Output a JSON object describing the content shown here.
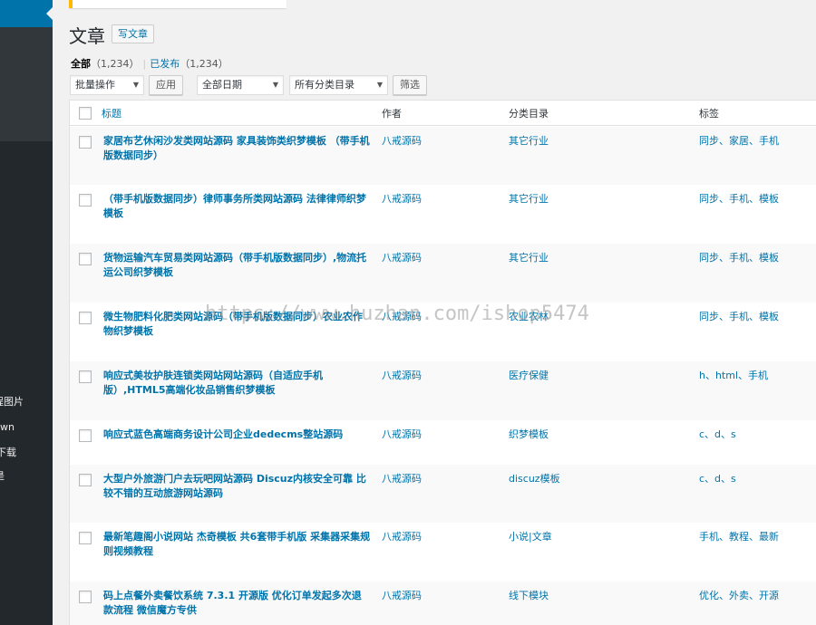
{
  "sidebar": {
    "items": [
      {
        "label": "远程图片"
      },
      {
        "label": "wn"
      },
      {
        "label": "下载"
      },
      {
        "label": "是"
      }
    ]
  },
  "header": {
    "title": "文章",
    "add_new_label": "写文章"
  },
  "filters": {
    "all_label": "全部",
    "all_count": "（1,234）",
    "separator": "|",
    "published_label": "已发布",
    "published_count": "（1,234）"
  },
  "toolbar": {
    "bulk_action": "批量操作",
    "apply_label": "应用",
    "date_filter": "全部日期",
    "category_filter": "所有分类目录",
    "filter_label": "筛选",
    "caret": "▼"
  },
  "table": {
    "columns": {
      "title": "标题",
      "author": "作者",
      "category": "分类目录",
      "tags": "标签"
    },
    "rows": [
      {
        "title": "家居布艺休闲沙发类网站源码 家具装饰类织梦模板 （带手机版数据同步）",
        "author": "八戒源码",
        "category": "其它行业",
        "tags": "同步、家居、手机"
      },
      {
        "title": "（带手机版数据同步）律师事务所类网站源码 法律律师织梦模板",
        "author": "八戒源码",
        "category": "其它行业",
        "tags": "同步、手机、模板"
      },
      {
        "title": "货物运输汽车贸易类网站源码（带手机版数据同步）,物流托运公司织梦模板",
        "author": "八戒源码",
        "category": "其它行业",
        "tags": "同步、手机、模板"
      },
      {
        "title": "微生物肥料化肥类网站源码（带手机版数据同步）农业农作物织梦模板",
        "author": "八戒源码",
        "category": "农业农林",
        "tags": "同步、手机、模板"
      },
      {
        "title": "响应式美妆护肤连锁类网站网站源码（自适应手机版）,HTML5高端化妆品销售织梦模板",
        "author": "八戒源码",
        "category": "医疗保健",
        "tags": "h、html、手机"
      },
      {
        "title": "响应式蓝色高端商务设计公司企业dedecms整站源码",
        "author": "八戒源码",
        "category": "织梦模板",
        "tags": "c、d、s"
      },
      {
        "title": "大型户外旅游门户去玩吧网站源码 Discuz内核安全可靠 比较不错的互动旅游网站源码",
        "author": "八戒源码",
        "category": "discuz模板",
        "tags": "c、d、s"
      },
      {
        "title": "最新笔趣阁小说网站 杰奇模板 共6套带手机版 采集器采集规则视频教程",
        "author": "八戒源码",
        "category": "小说|文章",
        "tags": "手机、教程、最新"
      },
      {
        "title": "码上点餐外卖餐饮系统 7.3.1 开源版 优化订单发起多次退款流程 微信魔方专供",
        "author": "八戒源码",
        "category": "线下模块",
        "tags": "优化、外卖、开源"
      }
    ]
  },
  "watermark": {
    "text": "https://www.huzhan.com/ishop5474"
  },
  "colors": {
    "sidebar_bg": "#23282d",
    "accent": "#0073aa",
    "notice": "#ffb900"
  }
}
